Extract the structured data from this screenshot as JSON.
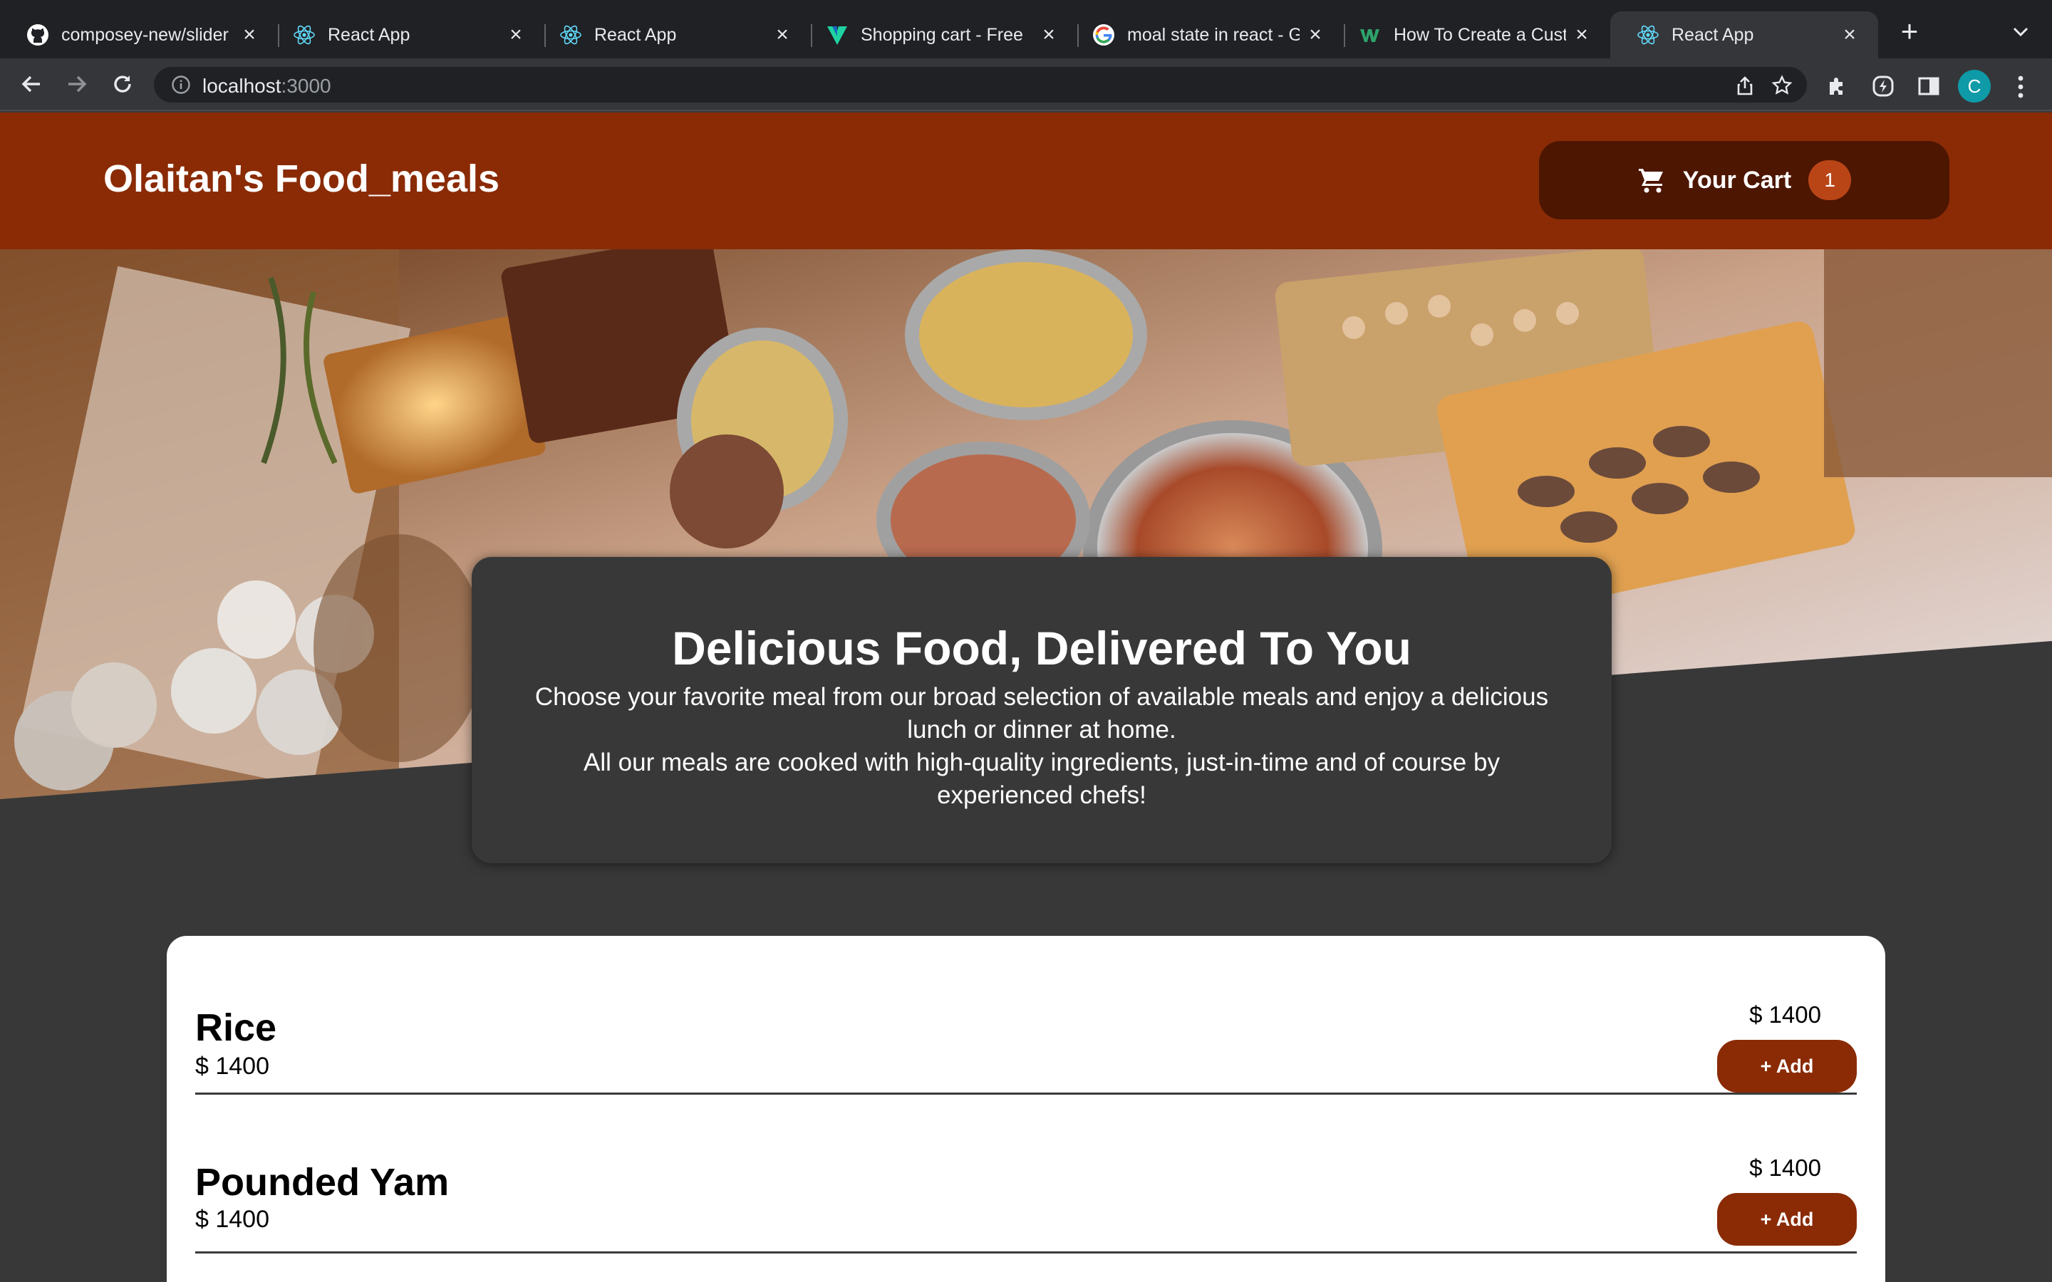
{
  "browser": {
    "tabs": [
      {
        "title": "composey-new/slider",
        "icon": "github-icon"
      },
      {
        "title": "React App",
        "icon": "react-icon"
      },
      {
        "title": "React App",
        "icon": "react-icon"
      },
      {
        "title": "Shopping cart - Free",
        "icon": "vuetify-icon"
      },
      {
        "title": "moal state in react - G",
        "icon": "google-icon"
      },
      {
        "title": "How To Create a Cust",
        "icon": "webflow-icon"
      },
      {
        "title": "React App",
        "icon": "react-icon",
        "active": true
      }
    ],
    "url_host": "localhost",
    "url_port": ":3000",
    "profile_initial": "C"
  },
  "header": {
    "brand": "Olaitan's Food_meals",
    "cart_label": "Your Cart",
    "cart_count": "1"
  },
  "summary": {
    "title": "Delicious Food, Delivered To You",
    "p1": "Choose your favorite meal from our broad selection of available meals and enjoy a delicious lunch or dinner at home.",
    "p2": "All our meals are cooked with high-quality ingredients, just-in-time and of course by experienced chefs!"
  },
  "meals": [
    {
      "name": "Rice",
      "price": "$ 1400",
      "amount": "$ 1400",
      "add_label": "+ Add"
    },
    {
      "name": "Pounded Yam",
      "price": "$ 1400",
      "amount": "$ 1400",
      "add_label": "+ Add"
    }
  ],
  "colors": {
    "header": "#8a2b06",
    "cart_button": "#4d1601",
    "badge": "#b94517",
    "page_bg": "#383838"
  }
}
